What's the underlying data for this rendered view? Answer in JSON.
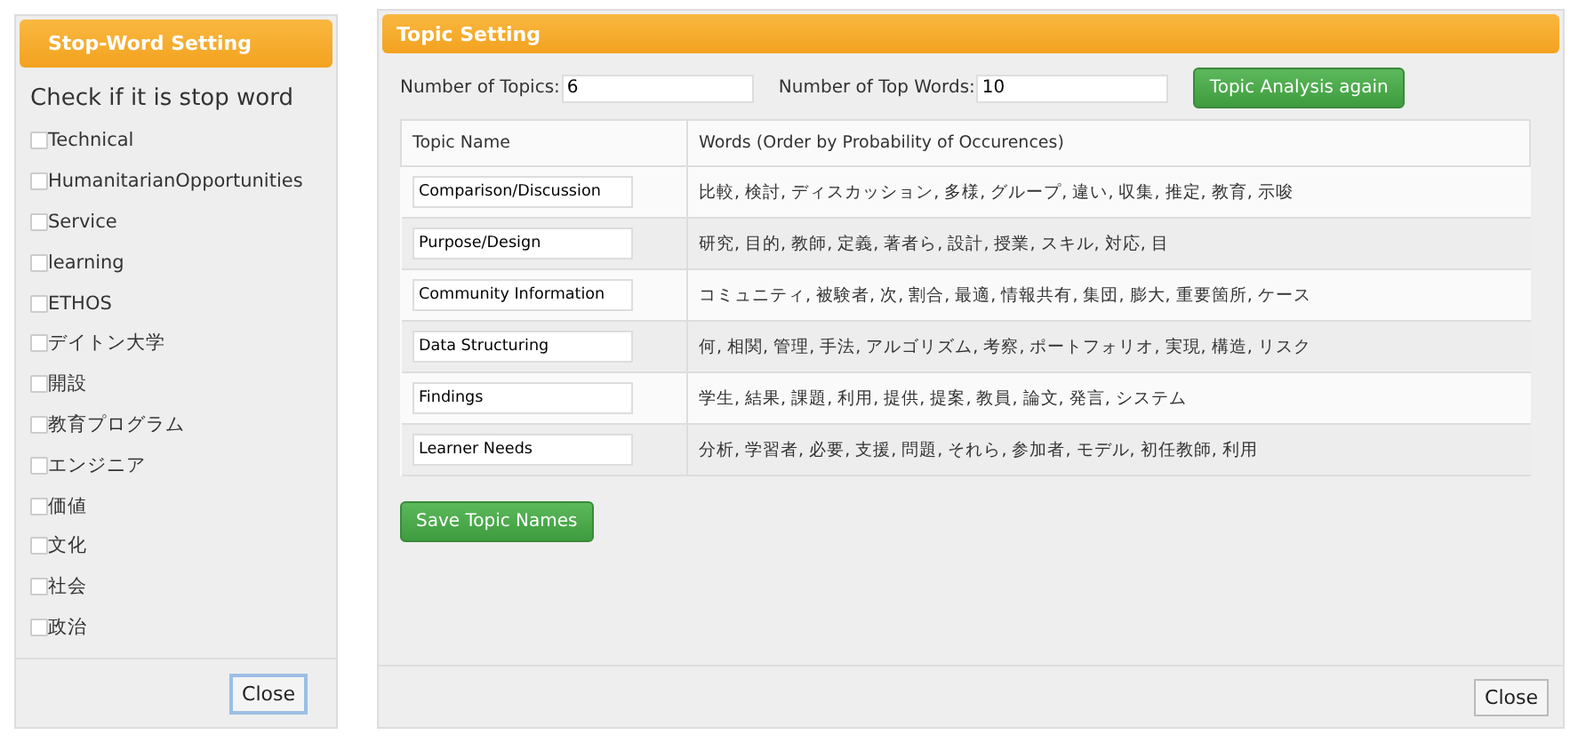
{
  "stop_word_dialog": {
    "title": "Stop-Word Setting",
    "heading": "Check if it is stop word",
    "words": [
      {
        "label": "Technical",
        "checked": false
      },
      {
        "label": "HumanitarianOpportunities",
        "checked": false
      },
      {
        "label": "Service",
        "checked": false
      },
      {
        "label": "learning",
        "checked": false
      },
      {
        "label": "ETHOS",
        "checked": false
      },
      {
        "label": "デイトン大学",
        "checked": false
      },
      {
        "label": "開設",
        "checked": false
      },
      {
        "label": "教育プログラム",
        "checked": false
      },
      {
        "label": "エンジニア",
        "checked": false
      },
      {
        "label": "価値",
        "checked": false
      },
      {
        "label": "文化",
        "checked": false
      },
      {
        "label": "社会",
        "checked": false
      },
      {
        "label": "政治",
        "checked": false
      }
    ],
    "close_button": "Close"
  },
  "topic_dialog": {
    "title": "Topic Setting",
    "num_topics": {
      "label": "Number of Topics:",
      "value": "6"
    },
    "num_top_words": {
      "label": "Number of Top Words:",
      "value": "10"
    },
    "analyze_button": "Topic Analysis again",
    "table": {
      "columns": [
        "Topic Name",
        "Words (Order by Probability of Occurences)"
      ],
      "rows": [
        {
          "name": "Comparison/Discussion",
          "words": "比較, 検討, ディスカッション, 多様, グループ, 違い, 収集, 推定, 教育, 示唆"
        },
        {
          "name": "Purpose/Design",
          "words": "研究, 目的, 教師, 定義, 著者ら, 設計, 授業, スキル, 対応, 目"
        },
        {
          "name": "Community Information",
          "words": "コミュニティ, 被験者, 次, 割合, 最適, 情報共有, 集団, 膨大, 重要箇所, ケース"
        },
        {
          "name": "Data Structuring",
          "words": "何, 相関, 管理, 手法, アルゴリズム, 考察, ポートフォリオ, 実現, 構造, リスク"
        },
        {
          "name": "Findings",
          "words": "学生, 結果, 課題, 利用, 提供, 提案, 教員, 論文, 発言, システム"
        },
        {
          "name": "Learner Needs",
          "words": "分析, 学習者, 必要, 支援, 問題, それら, 参加者, モデル, 初任教師, 利用"
        }
      ]
    },
    "save_button": "Save Topic Names",
    "close_button": "Close"
  }
}
